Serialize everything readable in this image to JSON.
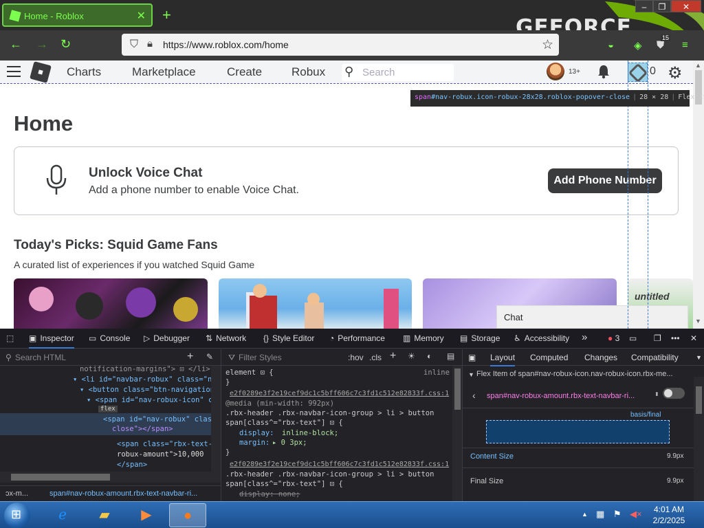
{
  "browser": {
    "tab_title": "Home - Roblox",
    "url": "https://www.roblox.com/home",
    "brand": "GEFORCE",
    "ext_badge": "15"
  },
  "roblox_header": {
    "nav": [
      "Charts",
      "Marketplace",
      "Create",
      "Robux"
    ],
    "search_placeholder": "Search",
    "age_badge": "13+",
    "robux_count": "0"
  },
  "tooltip": {
    "tag": "span",
    "selector": "#nav-robux.icon-robux-28x28.roblox-popover-close",
    "size": "28 × 28",
    "type": "Flex Item"
  },
  "page": {
    "title": "Home",
    "voice_title": "Unlock Voice Chat",
    "voice_sub": "Add a phone number to enable Voice Chat.",
    "phone_button": "Add Phone Number",
    "picks_title": "Today's Picks: Squid Game Fans",
    "picks_sub": "A curated list of experiences if you watched Squid Game",
    "chat": "Chat"
  },
  "devtools": {
    "tabs": [
      "Inspector",
      "Console",
      "Debugger",
      "Network",
      "Style Editor",
      "Performance",
      "Memory",
      "Storage",
      "Accessibility"
    ],
    "error_count": "3",
    "search_html": "Search HTML",
    "filter_styles": "Filter Styles",
    "hov": ":hov",
    "cls": ".cls",
    "layout_tabs": [
      "Layout",
      "Computed",
      "Changes",
      "Compatibility"
    ],
    "html_lines": [
      "notification-margins\"> ⊡ </li>",
      "▾ <li id=\"navbar-robux\" class=\"nav",
      "▾ <button class=\"btn-navigation-",
      "▾ <span id=\"nav-robux-icon\" cl",
      "flex",
      "<span id=\"nav-robux\" class=",
      "close\"></span>",
      "<span class=\"rbx-text-n",
      "robux-amount\">10,000",
      "</span>"
    ],
    "breadcrumb": [
      "ɔx-m...",
      "span#nav-robux-amount.rbx-text-navbar-ri..."
    ],
    "css_lines": [
      "element ⊡ {",
      "inline",
      "}",
      "e2f0289e3f2e19cef9dc1c5bff606c7c3fd1c512e82833f.css:1",
      "@media (min-width: 992px)",
      ".rbx-header .rbx-navbar-icon-group > li > button",
      "span[class^=\"rbx-text\"] ⊡ {",
      "display:",
      "inline-block;",
      "margin:",
      "▸ 0 3px;",
      "}",
      "e2f0289e3f2e19cef9dc1c5bff606c7c3fd1c512e82833f.css:1",
      ".rbx-header .rbx-navbar-icon-group > li > button",
      "span[class^=\"rbx-text\"] ⊡ {",
      "display: none;"
    ],
    "layout": {
      "flex_item_header": "Flex Item of span#nav-robux-icon.nav-robux-icon.rbx-me...",
      "flex_item_select": "span#nav-robux-amount.rbx-text-navbar-ri...",
      "basis_label": "basis/final",
      "content_size_label": "Content Size",
      "content_size": "9.9px",
      "final_size_label": "Final Size",
      "final_size": "9.9px"
    }
  },
  "taskbar": {
    "time": "4:01 AM",
    "date": "2/2/2025"
  },
  "colors": {
    "accent_green": "#7cff4f",
    "roblox_dark": "#393b3d",
    "devtools_bg": "#232327",
    "devtools_blue": "#3a7bd5"
  }
}
